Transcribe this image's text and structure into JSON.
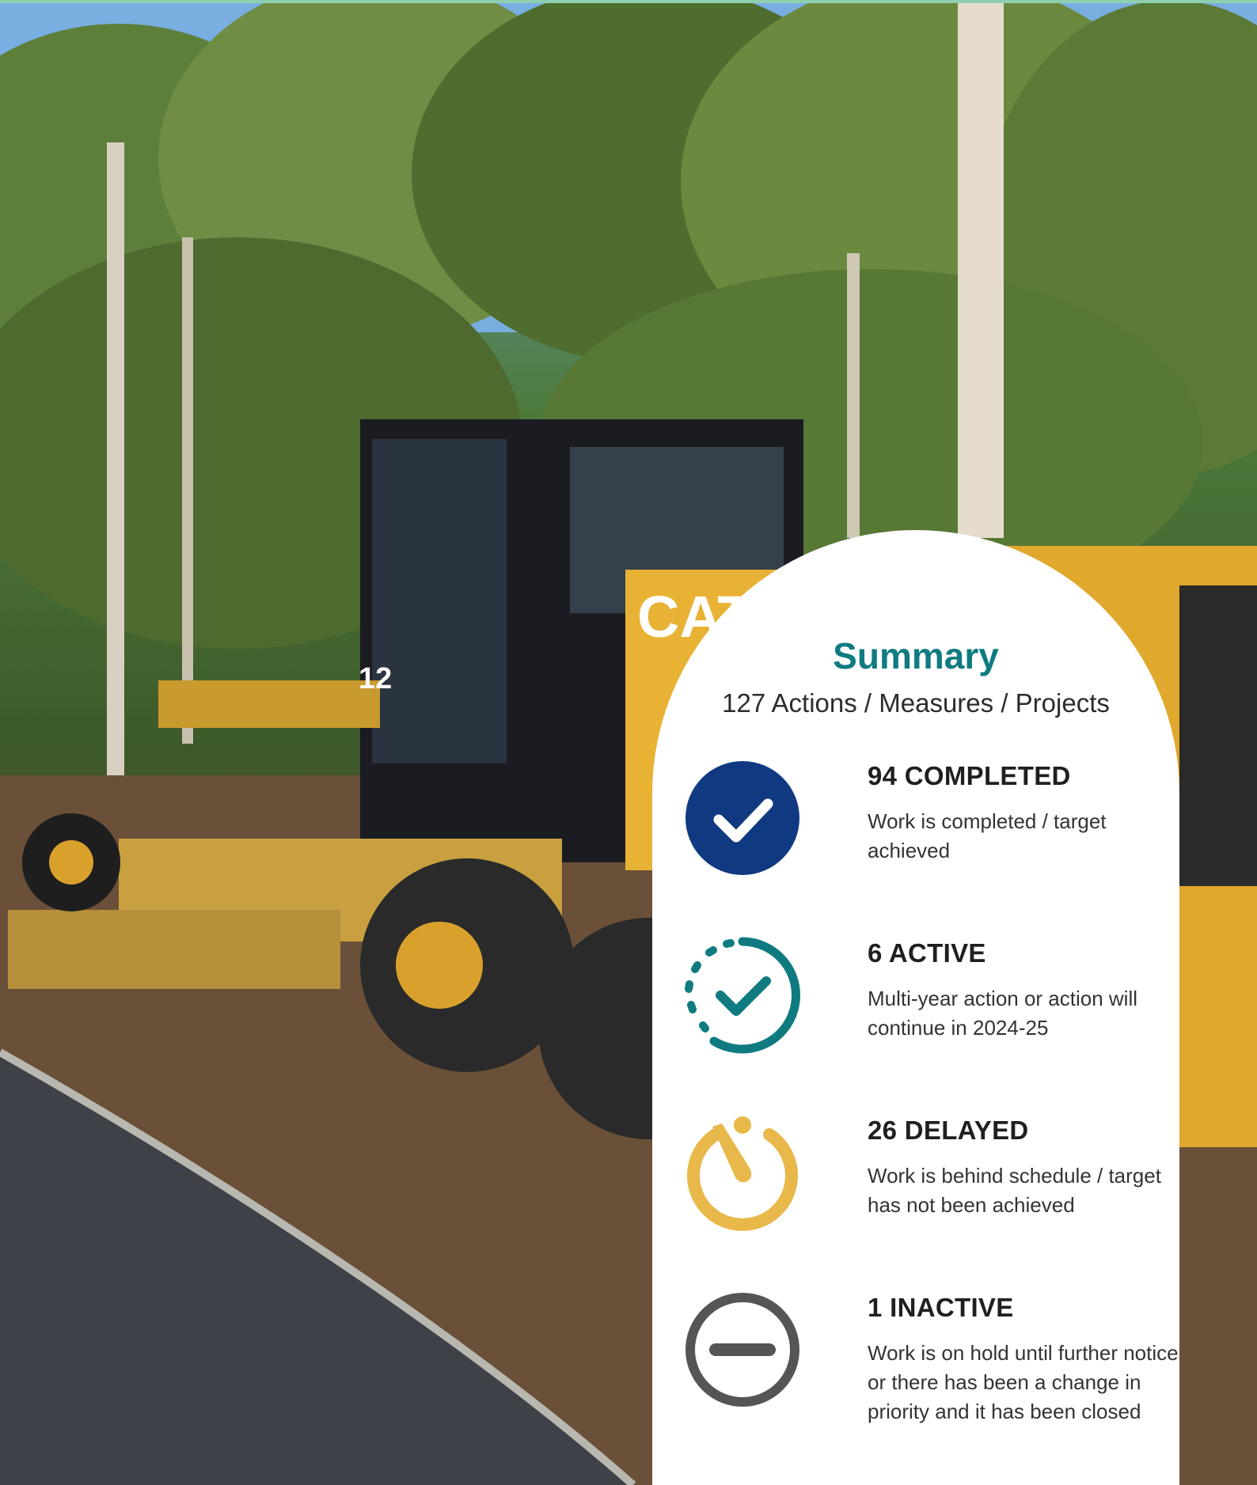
{
  "summary": {
    "title": "Summary",
    "subtitle": "127 Actions / Measures / Projects",
    "items": [
      {
        "label": "94 COMPLETED",
        "description": "Work is completed / target achieved",
        "color": "#0f3a82"
      },
      {
        "label": "6 ACTIVE",
        "description": "Multi-year action or action will continue in 2024-25",
        "color": "#0f7b80"
      },
      {
        "label": "26 DELAYED",
        "description": "Work is behind schedule / target has not been achieved",
        "color": "#e8b84a"
      },
      {
        "label": "1 INACTIVE",
        "description": "Work is on hold until further notice or there has been a change in priority and it has been closed",
        "color": "#555555"
      }
    ]
  },
  "photo": {
    "machine_text": [
      "CAT",
      "12"
    ]
  }
}
